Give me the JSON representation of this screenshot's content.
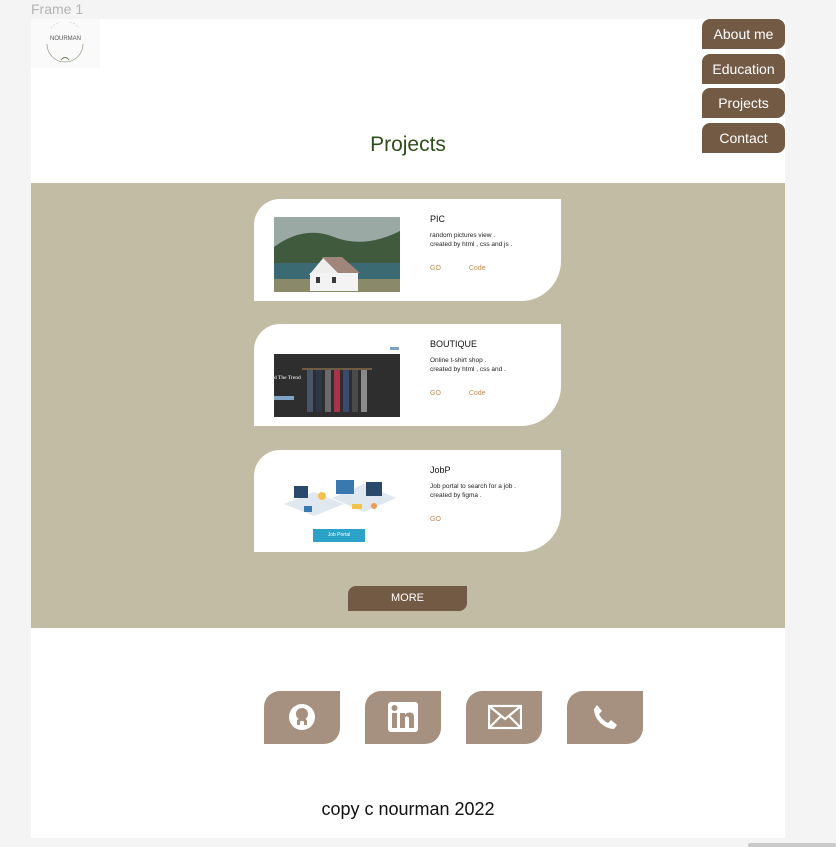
{
  "canvas": {
    "frame_label": "Frame 1"
  },
  "logo": {
    "text": "NOURMAN"
  },
  "nav": {
    "items": [
      {
        "label": "About me"
      },
      {
        "label": "Education"
      },
      {
        "label": "Projects"
      },
      {
        "label": "Contact"
      }
    ]
  },
  "page_title": "Projects",
  "projects": [
    {
      "title": "PIC",
      "description": " random pictures view .\ncreated by html , css and js .",
      "go_label": "GO",
      "code_label": "Code"
    },
    {
      "title": "BOUTIQUE",
      "description": "Online t-shirt shop .\ncreated by html , css and .",
      "go_label": "GO",
      "code_label": "Code"
    },
    {
      "title": "JobP",
      "description": "Job portal to search for a job .\ncreated by figma .",
      "go_label": "GO",
      "thumb_button": "Job Portal"
    }
  ],
  "thumb_text": {
    "boutique_heading": "d The Trend"
  },
  "more_label": "MORE",
  "footer": {
    "copyright": "copy c nourman 2022",
    "icons": [
      "github-icon",
      "linkedin-icon",
      "mail-icon",
      "phone-icon"
    ]
  },
  "colors": {
    "accent": "#735a45",
    "band": "#c3bca5",
    "social_bg": "#a69180",
    "title": "#2f4f1a",
    "link": "#c08a52"
  }
}
